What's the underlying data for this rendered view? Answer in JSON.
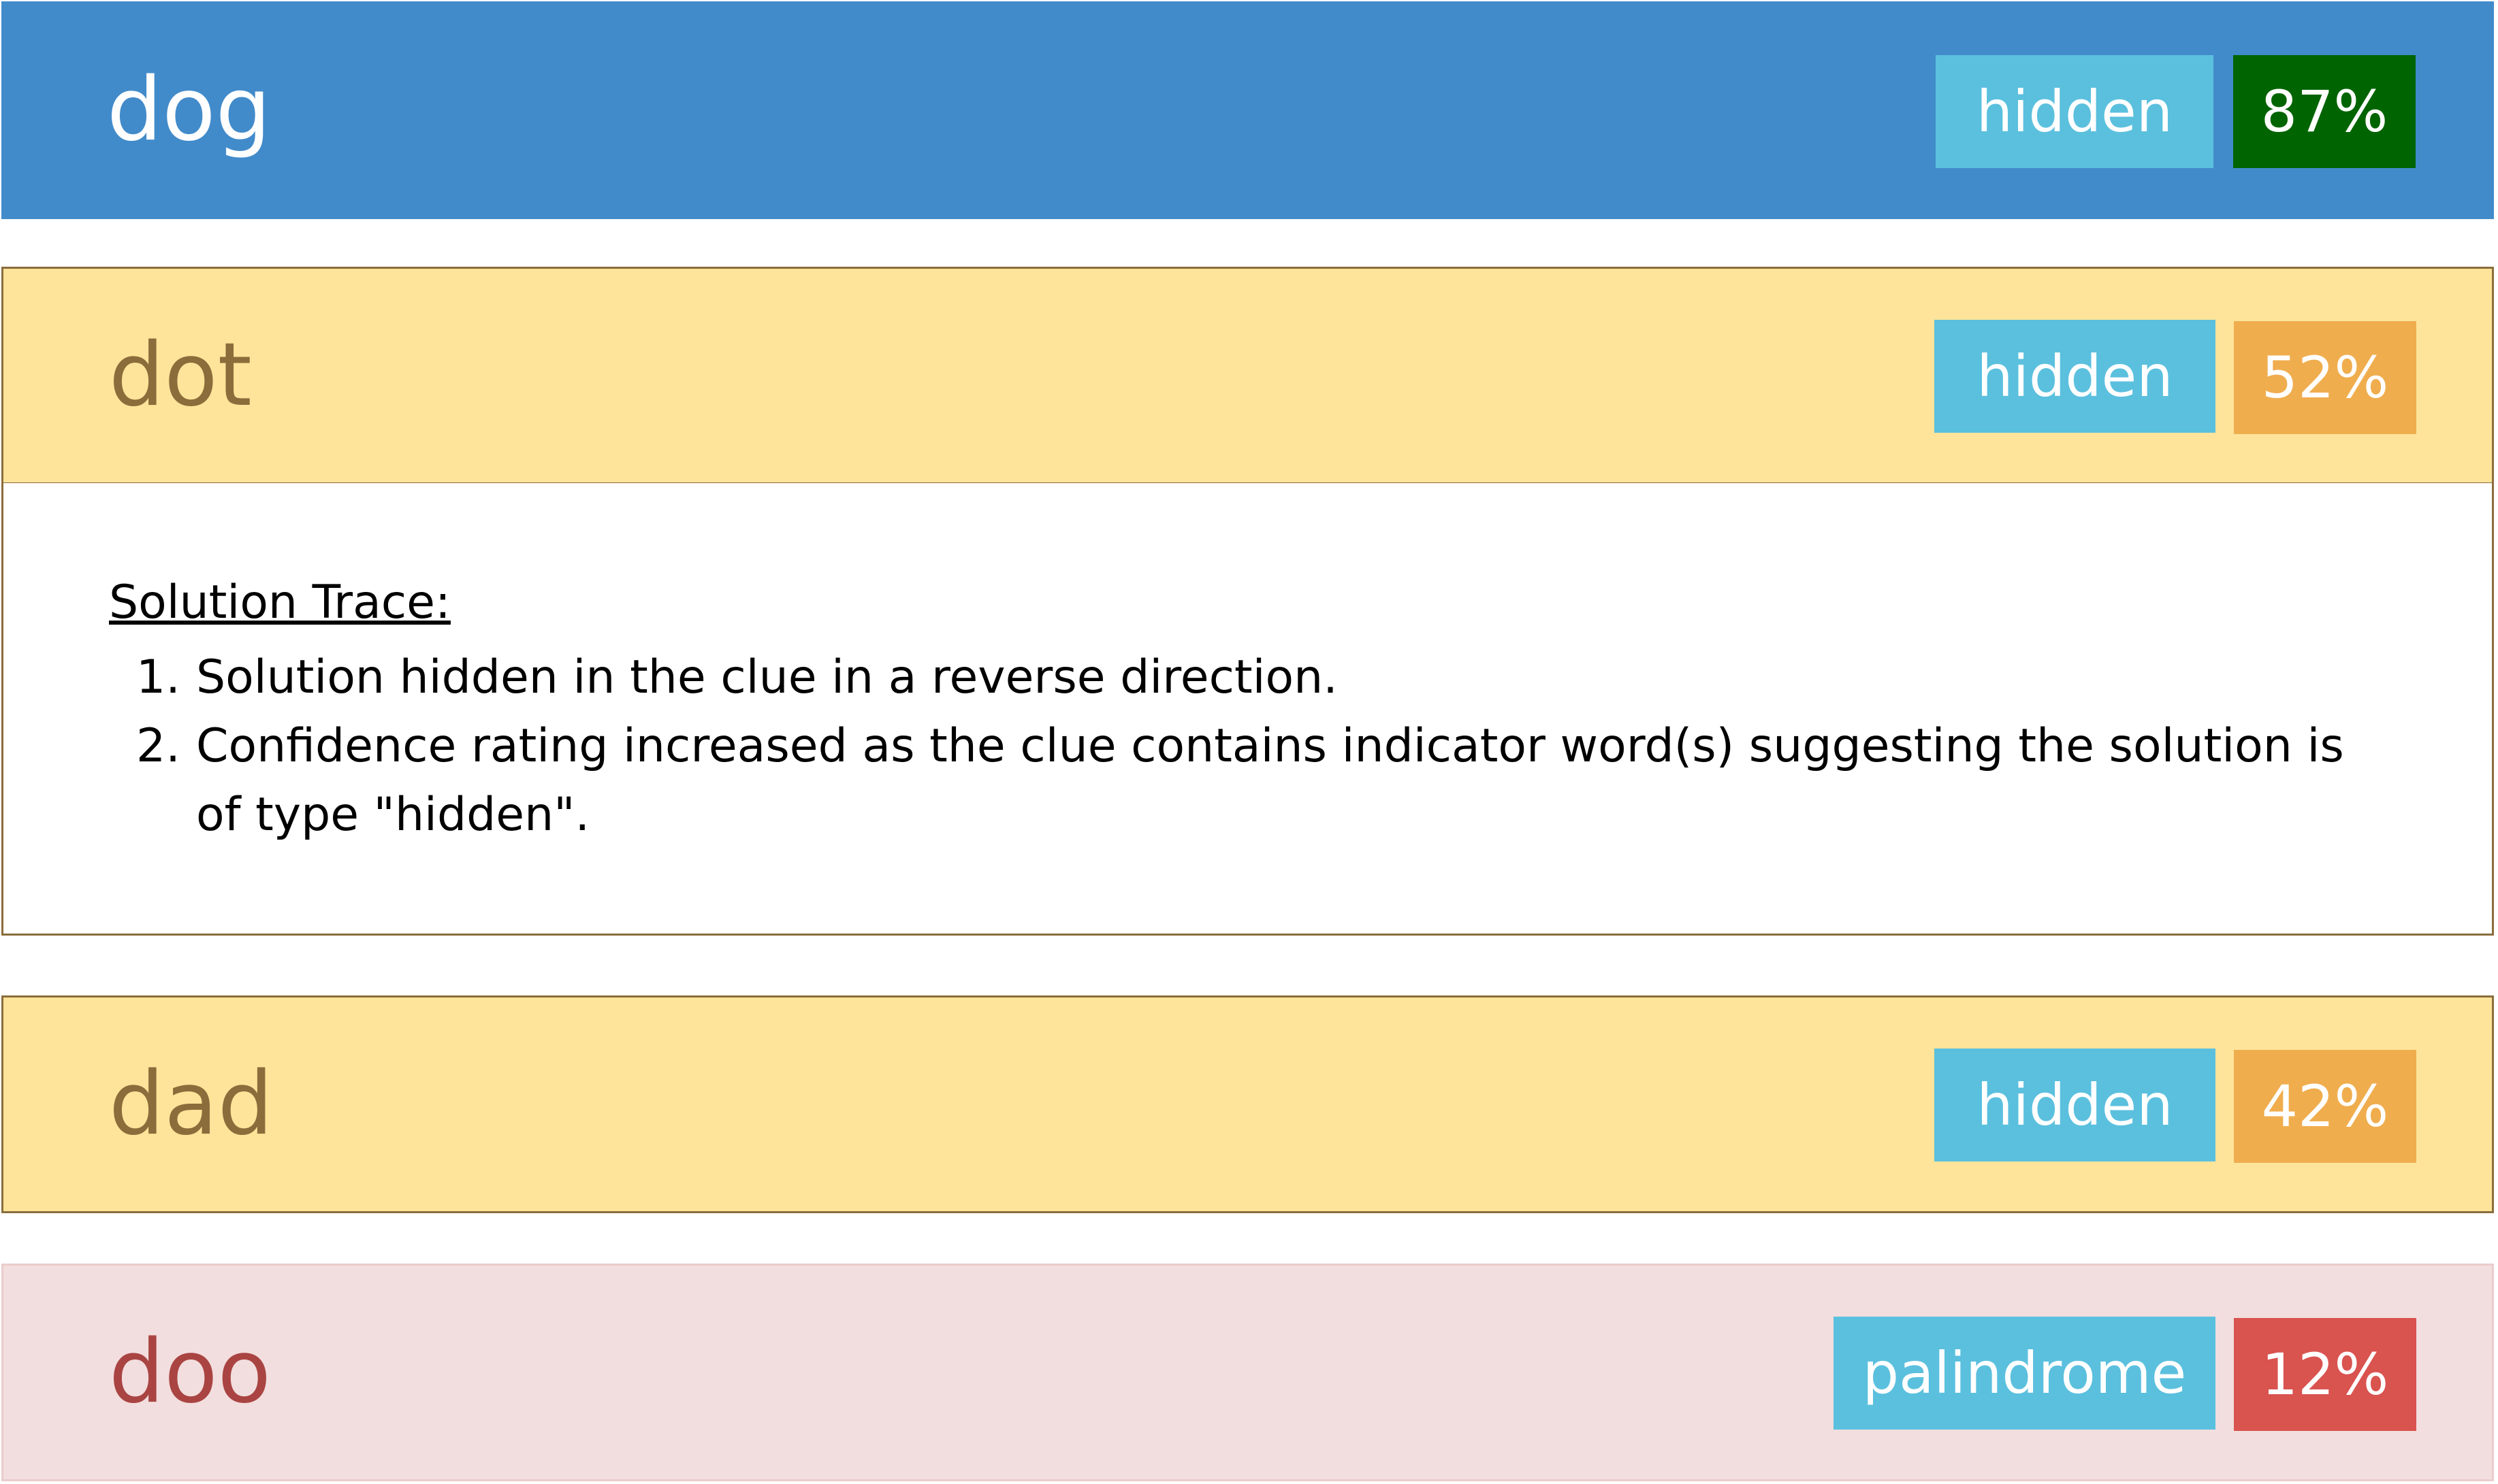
{
  "results": [
    {
      "word": "dog",
      "type": "hidden",
      "confidence": "87%"
    },
    {
      "word": "dot",
      "type": "hidden",
      "confidence": "52%"
    },
    {
      "word": "dad",
      "type": "hidden",
      "confidence": "42%"
    },
    {
      "word": "doo",
      "type": "palindrome",
      "confidence": "12%"
    }
  ],
  "trace": {
    "title": "Solution Trace:",
    "steps": [
      {
        "num": "1.",
        "text": "Solution hidden in the clue in a reverse direction."
      },
      {
        "num": "2.",
        "text": "Confidence rating increased as the clue contains indicator word(s) suggesting the solution is of type \"hidden\"."
      }
    ]
  },
  "colors": {
    "selected_row": "#428bca",
    "medium_row": "#fee49a",
    "low_row": "#f2dede",
    "type_badge": "#5bc0de",
    "high_confidence": "#006400",
    "medium_confidence": "#f0ad4e",
    "low_confidence": "#d9534f"
  }
}
